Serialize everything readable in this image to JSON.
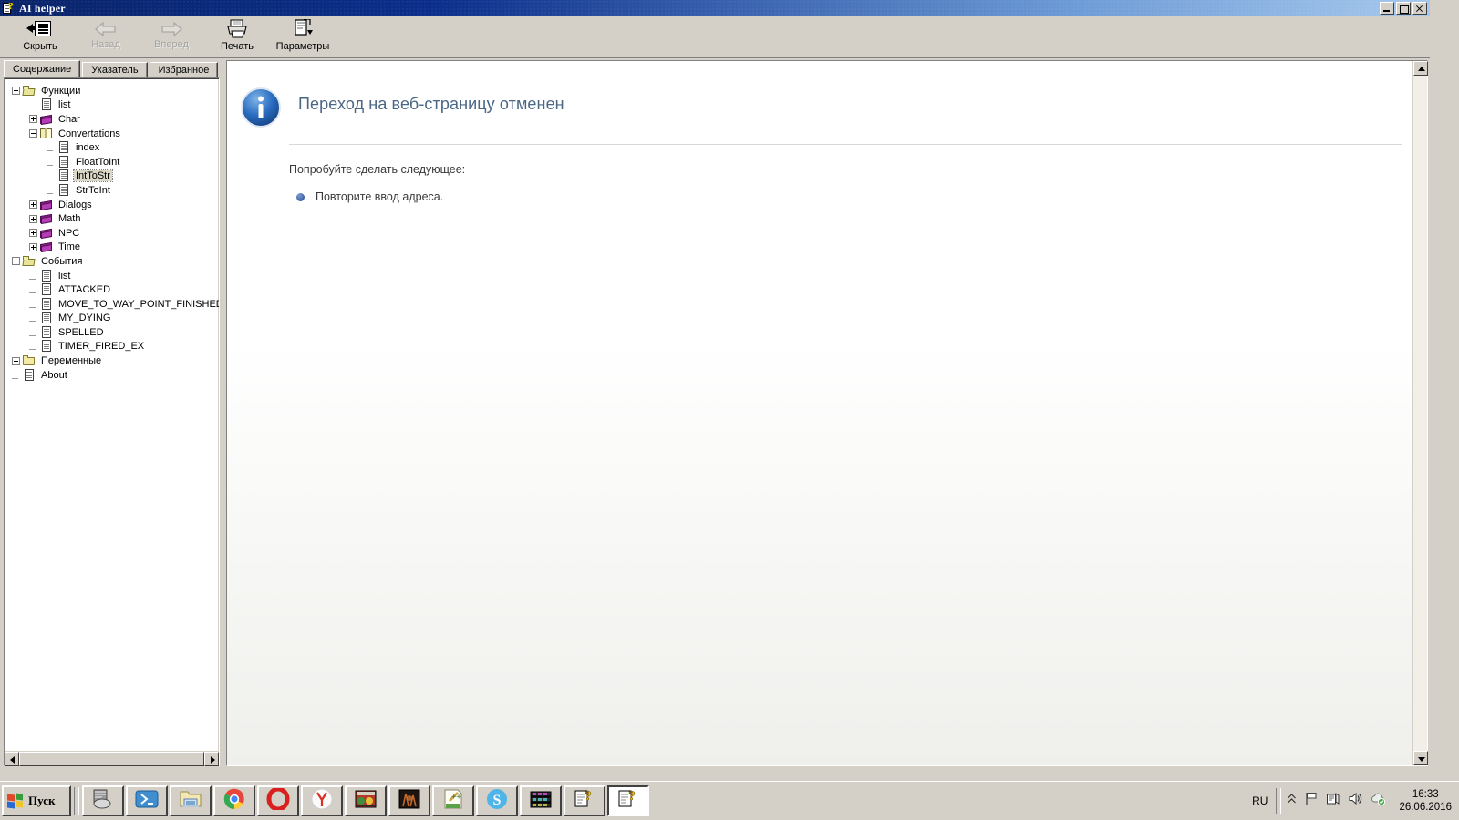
{
  "window": {
    "title": "AI helper",
    "icon": "help-document-icon",
    "controls": {
      "minimize": "minimize-button",
      "maximize": "maximize-button",
      "close": "close-button"
    }
  },
  "toolbar": {
    "buttons": [
      {
        "label": "Скрыть",
        "icon": "hide-pane-icon",
        "disabled": false
      },
      {
        "label": "Назад",
        "icon": "back-arrow-icon",
        "disabled": true
      },
      {
        "label": "Вперед",
        "icon": "forward-arrow-icon",
        "disabled": true
      },
      {
        "label": "Печать",
        "icon": "printer-icon",
        "disabled": false
      },
      {
        "label": "Параметры",
        "icon": "options-icon",
        "disabled": false
      }
    ]
  },
  "nav": {
    "tabs": [
      {
        "label": "Содержание",
        "active": true
      },
      {
        "label": "Указатель",
        "active": false
      },
      {
        "label": "Избранное",
        "active": false
      }
    ],
    "tree": [
      {
        "label": "Функции",
        "icon": "folder-open-icon",
        "depth": 0,
        "expander": "minus",
        "selected": false
      },
      {
        "label": "list",
        "icon": "page-icon",
        "depth": 1,
        "expander": "none",
        "selected": false
      },
      {
        "label": "Char",
        "icon": "book-icon",
        "depth": 1,
        "expander": "plus",
        "selected": false
      },
      {
        "label": "Convertations",
        "icon": "book-open-icon",
        "depth": 1,
        "expander": "minus",
        "selected": false
      },
      {
        "label": "index",
        "icon": "page-icon",
        "depth": 2,
        "expander": "none",
        "selected": false
      },
      {
        "label": "FloatToInt",
        "icon": "page-icon",
        "depth": 2,
        "expander": "none",
        "selected": false
      },
      {
        "label": "IntToStr",
        "icon": "page-icon",
        "depth": 2,
        "expander": "none",
        "selected": true
      },
      {
        "label": "StrToInt",
        "icon": "page-icon",
        "depth": 2,
        "expander": "none",
        "selected": false
      },
      {
        "label": "Dialogs",
        "icon": "book-icon",
        "depth": 1,
        "expander": "plus",
        "selected": false
      },
      {
        "label": "Math",
        "icon": "book-icon",
        "depth": 1,
        "expander": "plus",
        "selected": false
      },
      {
        "label": "NPC",
        "icon": "book-icon",
        "depth": 1,
        "expander": "plus",
        "selected": false
      },
      {
        "label": "Time",
        "icon": "book-icon",
        "depth": 1,
        "expander": "plus",
        "selected": false
      },
      {
        "label": "События",
        "icon": "folder-open-icon",
        "depth": 0,
        "expander": "minus",
        "selected": false
      },
      {
        "label": "list",
        "icon": "page-icon",
        "depth": 1,
        "expander": "none",
        "selected": false
      },
      {
        "label": "ATTACKED",
        "icon": "page-icon",
        "depth": 1,
        "expander": "none",
        "selected": false
      },
      {
        "label": "MOVE_TO_WAY_POINT_FINISHED",
        "icon": "page-icon",
        "depth": 1,
        "expander": "none",
        "selected": false
      },
      {
        "label": "MY_DYING",
        "icon": "page-icon",
        "depth": 1,
        "expander": "none",
        "selected": false
      },
      {
        "label": "SPELLED",
        "icon": "page-icon",
        "depth": 1,
        "expander": "none",
        "selected": false
      },
      {
        "label": "TIMER_FIRED_EX",
        "icon": "page-icon",
        "depth": 1,
        "expander": "none",
        "selected": false
      },
      {
        "label": "Переменные",
        "icon": "folder-icon",
        "depth": 0,
        "expander": "plus",
        "selected": false
      },
      {
        "label": "About",
        "icon": "page-icon",
        "depth": 0,
        "expander": "none",
        "selected": false
      }
    ]
  },
  "content": {
    "icon": "info-icon",
    "title": "Переход на веб-страницу отменен",
    "subtitle": "Попробуйте сделать следующее:",
    "suggestions": [
      "Повторите ввод адреса."
    ]
  },
  "taskbar": {
    "start_label": "Пуск",
    "items": [
      {
        "name": "task-unknown-grey",
        "active": false
      },
      {
        "name": "task-powershell",
        "active": false
      },
      {
        "name": "task-explorer",
        "active": false
      },
      {
        "name": "task-chrome",
        "active": false
      },
      {
        "name": "task-opera",
        "active": false
      },
      {
        "name": "task-yandex",
        "active": false
      },
      {
        "name": "task-game-editor",
        "active": false
      },
      {
        "name": "task-game-dark",
        "active": false
      },
      {
        "name": "task-notepadpp",
        "active": false
      },
      {
        "name": "task-skype",
        "active": false
      },
      {
        "name": "task-winrar",
        "active": false
      },
      {
        "name": "task-help-1",
        "active": false
      },
      {
        "name": "task-help-2",
        "active": true
      }
    ],
    "tray": {
      "language": "RU",
      "icons": [
        "chevron-up-icon",
        "flag-icon",
        "network-icon",
        "volume-icon",
        "update-icon"
      ],
      "time": "16:33",
      "date": "26.06.2016"
    }
  },
  "colors": {
    "title_bar_start": "#0a246a",
    "title_bar_end": "#a6c8ec",
    "face": "#d4d0c8",
    "heading": "#4a6785",
    "book": "#8e1f8e",
    "folder": "#f5e9a8"
  }
}
